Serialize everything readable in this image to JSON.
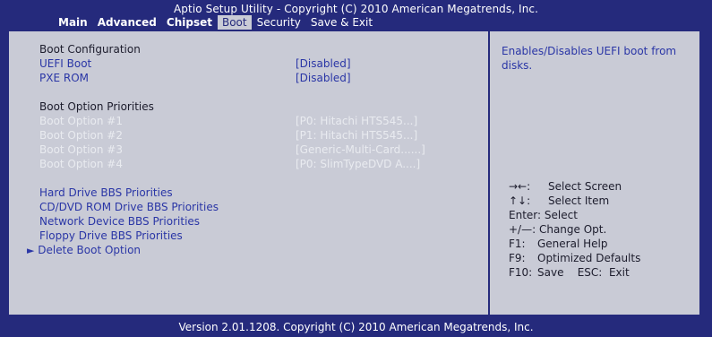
{
  "header": {
    "title": "Aptio Setup Utility - Copyright (C) 2010 American Megatrends, Inc.",
    "tabs": [
      {
        "label": "Main"
      },
      {
        "label": "Advanced"
      },
      {
        "label": "Chipset"
      },
      {
        "label": "Boot"
      },
      {
        "label": "Security"
      },
      {
        "label": "Save & Exit"
      }
    ]
  },
  "boot": {
    "config_heading": "Boot Configuration",
    "uefi_label": "UEFI Boot",
    "uefi_value": "[Disabled]",
    "pxe_label": "PXE ROM",
    "pxe_value": "[Disabled]",
    "priorities_heading": "Boot Option Priorities",
    "options": [
      {
        "label": "Boot Option #1",
        "value": "[P0:  Hitachi HTS545...]"
      },
      {
        "label": "Boot Option #2",
        "value": "[P1:  Hitachi HTS545...]"
      },
      {
        "label": "Boot Option #3",
        "value": "[Generic-Multi-Card......]"
      },
      {
        "label": "Boot Option #4",
        "value": "[P0:  SlimTypeDVD A....]"
      }
    ],
    "bbs": [
      {
        "label": "Hard Drive BBS Priorities"
      },
      {
        "label": "CD/DVD ROM Drive BBS Priorities"
      },
      {
        "label": "Network Device BBS Priorities"
      },
      {
        "label": "Floppy Drive BBS Priorities"
      }
    ],
    "delete_label": "Delete Boot Option",
    "delete_pointer": "►"
  },
  "help": {
    "description": "Enables/Disables UEFI boot from disks.",
    "keys": [
      {
        "key": "→←:",
        "desc": "Select Screen"
      },
      {
        "key": "↑↓:",
        "desc": "Select Item"
      },
      {
        "key": "Enter:",
        "desc": "Select"
      },
      {
        "key": "+/—:",
        "desc": "Change Opt."
      },
      {
        "key": "F1:",
        "desc": "General Help"
      },
      {
        "key": "F9:",
        "desc": "Optimized Defaults"
      },
      {
        "key": "F10:",
        "desc": "Save    ESC:  Exit"
      }
    ]
  },
  "footer": {
    "text": "Version 2.01.1208. Copyright (C) 2010 American Megatrends, Inc."
  },
  "colors": {
    "background": "#252a7c",
    "panel": "#c9cbd6",
    "link": "#2a36a6",
    "dim": "#e9ebf0",
    "text": "#1c1c2c"
  }
}
